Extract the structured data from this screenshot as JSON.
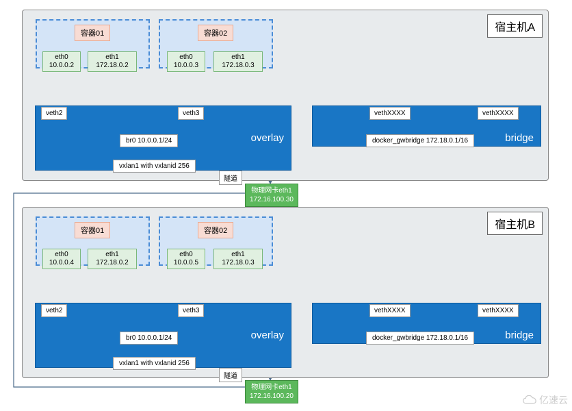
{
  "hostA": {
    "title": "宿主机A",
    "c1": {
      "label": "容器01",
      "eth0": "eth0\n10.0.0.2",
      "eth1": "eth1\n172.18.0.2"
    },
    "c2": {
      "label": "容器02",
      "eth0": "eth0\n10.0.0.3",
      "eth1": "eth1\n172.18.0.3"
    },
    "veth2": "veth2",
    "veth3": "veth3",
    "vethx1": "vethXXXX",
    "vethx2": "vethXXXX",
    "br0": "br0 10.0.0.1/24",
    "overlay": "overlay",
    "gwbridge": "docker_gwbridge 172.18.0.1/16",
    "bridge": "bridge",
    "vxlan": "vxlan1 with vxlanid 256",
    "tunnel": "隧道",
    "nic": "物理网卡eth1\n172.16.100.30"
  },
  "hostB": {
    "title": "宿主机B",
    "c1": {
      "label": "容器01",
      "eth0": "eth0\n10.0.0.4",
      "eth1": "eth1\n172.18.0.2"
    },
    "c2": {
      "label": "容器02",
      "eth0": "eth0\n10.0.0.5",
      "eth1": "eth1\n172.18.0.3"
    },
    "veth2": "veth2",
    "veth3": "veth3",
    "vethx1": "vethXXXX",
    "vethx2": "vethXXXX",
    "br0": "br0 10.0.0.1/24",
    "overlay": "overlay",
    "gwbridge": "docker_gwbridge 172.18.0.1/16",
    "bridge": "bridge",
    "vxlan": "vxlan1 with vxlanid 256",
    "tunnel": "隧道",
    "nic": "物理网卡eth1\n172.16.100.20"
  },
  "watermark": "亿速云"
}
